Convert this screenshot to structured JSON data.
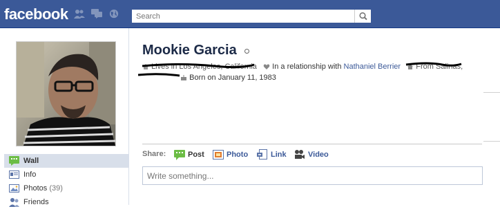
{
  "topbar": {
    "logo": "facebook",
    "search_placeholder": "Search"
  },
  "sidebar": {
    "items": [
      {
        "label": "Wall",
        "count": ""
      },
      {
        "label": "Info",
        "count": ""
      },
      {
        "label": "Photos",
        "count": "(39)"
      },
      {
        "label": "Friends",
        "count": ""
      }
    ]
  },
  "profile": {
    "name": "Mookie Garcia",
    "lives_in": "Lives in Los Angeles, California",
    "relationship_prefix": "In a relationship with",
    "partner": "Nathaniel Berrier",
    "from": "From Salinas,",
    "born": "Born on January 11, 1983"
  },
  "publisher": {
    "share_label": "Share:",
    "options": [
      "Post",
      "Photo",
      "Link",
      "Video"
    ],
    "placeholder": "Write something..."
  },
  "colors": {
    "brand": "#3b5998",
    "nav_active": "#d8dfea"
  }
}
